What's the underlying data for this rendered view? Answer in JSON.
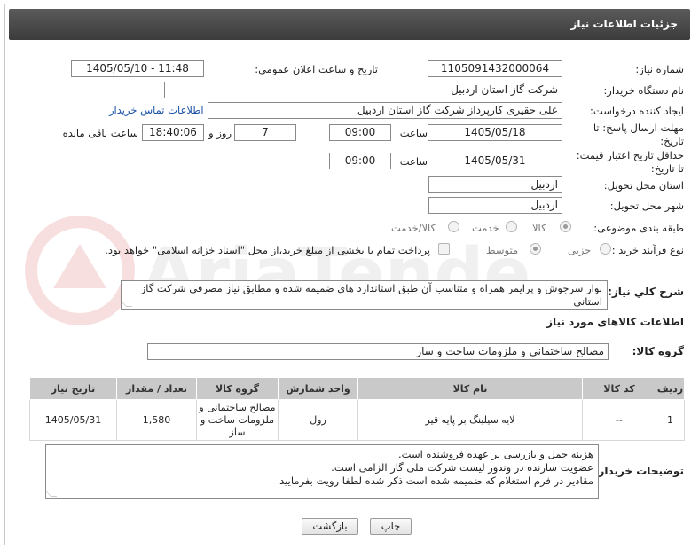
{
  "header": {
    "title": "جزئیات اطلاعات نیاز"
  },
  "fields": {
    "need_number_label": "شماره نیاز:",
    "need_number": "1105091432000064",
    "announce_label": "تاریخ و ساعت اعلان عمومی:",
    "announce_value": "1405/05/10 - 11:48",
    "buyer_org_label": "نام دستگاه خریدار:",
    "buyer_org": "شرکت گاز استان اردبیل",
    "creator_label": "ایجاد کننده درخواست:",
    "creator": "علی حقیری کارپرداز شرکت گاز استان اردبیل",
    "contact_link": "اطلاعات تماس خریدار",
    "deadline_label_1": "مهلت ارسال پاسخ: تا",
    "deadline_label_2": "تاریخ:",
    "deadline_date": "1405/05/18",
    "time_label": "ساعت",
    "deadline_time": "09:00",
    "days_value": "7",
    "days_label": "روز و",
    "remaining_time": "18:40:06",
    "remaining_label": "ساعت باقی مانده",
    "validity_label_1": "حداقل تاریخ اعتبار قیمت:",
    "validity_label_2": "تا تاریخ:",
    "validity_date": "1405/05/31",
    "validity_time": "09:00",
    "province_label": "استان محل تحویل:",
    "province": "اردبیل",
    "city_label": "شهر محل تحویل:",
    "city": "اردبیل",
    "category_label": "طبقه بندی موضوعی:",
    "category_options": [
      "کالا",
      "خدمت",
      "کالا/خدمت"
    ],
    "process_label": "نوع فرآیند خرید :",
    "process_options": [
      "جزیی",
      "متوسط"
    ],
    "payment_note": "پرداخت تمام یا بخشی از مبلغ خرید،از محل \"اسناد خزانه اسلامی\" خواهد بود."
  },
  "description": {
    "label": "شرح کلي نياز:",
    "text": "نوار سرجوش و پرایمر همراه و متناسب آن طبق استاندارد های ضمیمه شده و مطابق نیاز مصرفی شرکت گاز استانی"
  },
  "goods": {
    "section_title": "اطلاعات کالاهای مورد نیاز",
    "group_label": "گروه کالا:",
    "group_value": "مصالح ساختمانی و ملزومات ساخت و ساز",
    "columns": [
      "ردیف",
      "کد کالا",
      "نام کالا",
      "واحد شمارش",
      "گروه کالا",
      "تعداد / مقدار",
      "تاریخ نیاز"
    ],
    "rows": [
      [
        "1",
        "--",
        "لایه سیلینگ بر پایه قیر",
        "رول",
        "مصالح ساختمانی و ملزومات ساخت و ساز",
        "1,580",
        "1405/05/31"
      ]
    ]
  },
  "buyer_notes": {
    "label": "توضیحات خریدار:",
    "lines": [
      "هزینه حمل و بازرسی بر عهده فروشنده است.",
      "عضویت سازنده در وندور لیست شرکت ملی گاز الزامی است.",
      "مقادیر در فرم استعلام که ضمیمه شده است ذکر شده لطفا رویت بفرمایید"
    ]
  },
  "buttons": {
    "print": "چاپ",
    "back": "بازگشت"
  },
  "colors": {
    "header_bg": "#4a4a4a",
    "link": "#1a52a8",
    "table_head": "#c9c9c9"
  },
  "watermark": "AriaTender.net"
}
